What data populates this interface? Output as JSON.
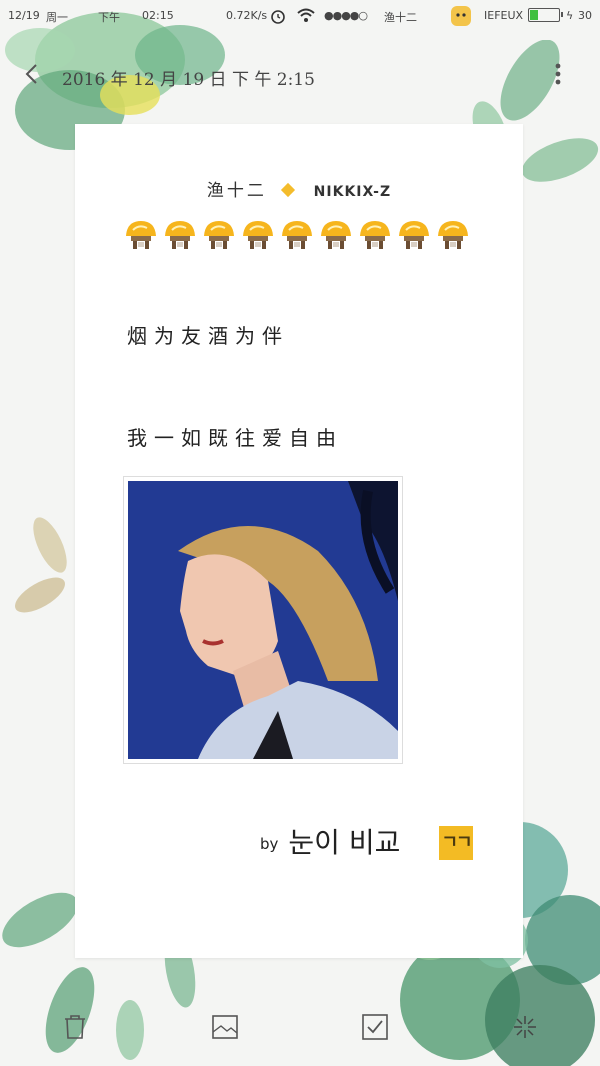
{
  "status_bar": {
    "date": "12/19",
    "weekday": "周一",
    "ampm": "下午",
    "time": "02:15",
    "speed": "0.72K/s",
    "carrier": "渔十二",
    "network": "IEFEUX",
    "battery_level": "30",
    "battery_fraction": 0.3
  },
  "header": {
    "date_title": "2016 年 12 月 19 日  下 午 2:15",
    "back_icon": "chevron-left-icon",
    "more_icon": "vertical-dots-icon"
  },
  "note": {
    "author_cn": "渔十二",
    "author_en": "NIKKIX-Z",
    "emoji_icon": "duck-emoji-icon",
    "emoji_count": 9,
    "line1": "烟为友酒为伴",
    "line2": "我一如既往爱自由",
    "signature_by": "by",
    "signature_name": "눈이 비교",
    "signature_badge": "ㄱㄱ"
  },
  "toolbar": {
    "delete_icon": "trash-icon",
    "image_icon": "image-icon",
    "checklist_icon": "checkbox-icon",
    "theme_icon": "star-burst-icon"
  },
  "colors": {
    "accent": "#f4bc2c",
    "battery": "#3fbf3f",
    "leaf_dark": "#5d9a74",
    "leaf_light": "#a8d6a8"
  }
}
